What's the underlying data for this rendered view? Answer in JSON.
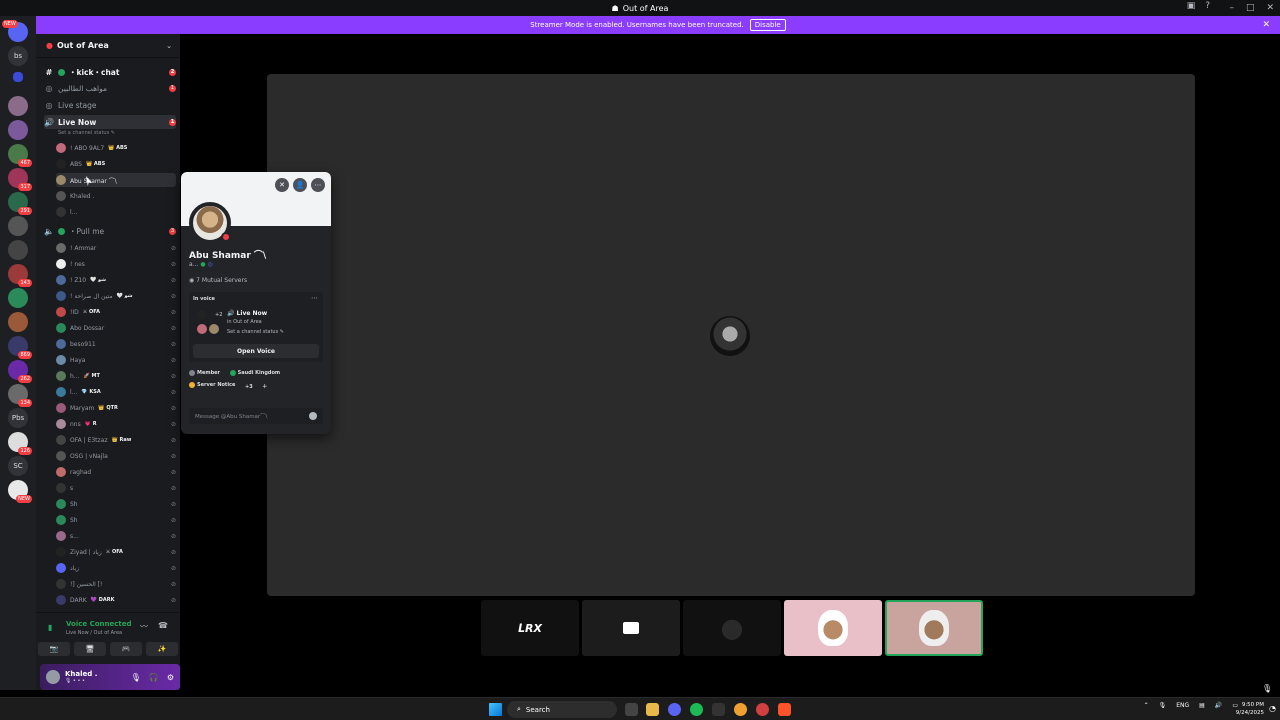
{
  "window": {
    "title": "Out of Area",
    "controls": [
      "–",
      "□",
      "✕"
    ]
  },
  "banner": {
    "text": "Streamer Mode is enabled. Usernames have been truncated.",
    "button": "Disable"
  },
  "rail": {
    "items": [
      {
        "label": "",
        "badge": "NEW"
      },
      {
        "label": "bs",
        "badge": ""
      },
      {
        "label": "",
        "badge": ""
      },
      {
        "label": "",
        "badge": ""
      },
      {
        "label": "",
        "badge": ""
      },
      {
        "label": "",
        "badge": "467"
      },
      {
        "label": "",
        "badge": "317"
      },
      {
        "label": "",
        "badge": "291"
      },
      {
        "label": "",
        "badge": ""
      },
      {
        "label": "",
        "badge": ""
      },
      {
        "label": "",
        "badge": "143"
      },
      {
        "label": "",
        "badge": ""
      },
      {
        "label": "",
        "badge": ""
      },
      {
        "label": "",
        "badge": "869"
      },
      {
        "label": "",
        "badge": "262"
      },
      {
        "label": "",
        "badge": "134"
      },
      {
        "label": "Pbs",
        "badge": ""
      },
      {
        "label": "",
        "badge": "126"
      },
      {
        "label": "SC",
        "badge": ""
      },
      {
        "label": "",
        "badge": "NEW"
      }
    ]
  },
  "server": {
    "name": "Out of Area"
  },
  "channels": {
    "kick_chat": {
      "name": "・kick・chat",
      "mention": "2"
    },
    "c2": {
      "name": "مواهب الطالبين",
      "mention": "1"
    },
    "live_stage": {
      "name": "Live stage"
    },
    "live_now": {
      "name": "Live Now",
      "mention": "1",
      "status": "Set a channel status ✎"
    },
    "pull_me": {
      "name": "・Pull me",
      "mention": "3"
    }
  },
  "live_now_users": [
    {
      "name": "! ABO 9AL7",
      "tag": "👑 ABS"
    },
    {
      "name": "ABS",
      "tag": "👑 ABS"
    },
    {
      "name": "Abu Shamar ⌒\\",
      "tag": ""
    },
    {
      "name": "Khaled .",
      "tag": ""
    },
    {
      "name": "l...",
      "tag": ""
    }
  ],
  "pull_me_users": [
    {
      "name": "! Ammar",
      "tag": ""
    },
    {
      "name": "! nes",
      "tag": ""
    },
    {
      "name": "! Z10",
      "tag": "🤍 شو"
    },
    {
      "name": "! متين ال صراحة",
      "tag": "🤍 شو"
    },
    {
      "name": "!ID",
      "tag": "⚔ OFA"
    },
    {
      "name": "Abo Dossar",
      "tag": ""
    },
    {
      "name": "beso911",
      "tag": ""
    },
    {
      "name": "Haya",
      "tag": ""
    },
    {
      "name": "h...",
      "tag": "🚀 MT"
    },
    {
      "name": "l...",
      "tag": "💎 KSA"
    },
    {
      "name": "Maryam",
      "tag": "👑 QTR"
    },
    {
      "name": "nns",
      "tag": "💗 R"
    },
    {
      "name": "OFA | E3tzaz",
      "tag": "👑 Raw"
    },
    {
      "name": "OSG | vNajla",
      "tag": ""
    },
    {
      "name": "raghad",
      "tag": ""
    },
    {
      "name": "s",
      "tag": ""
    },
    {
      "name": "Sh",
      "tag": ""
    },
    {
      "name": "Sh",
      "tag": ""
    },
    {
      "name": "s...",
      "tag": ""
    },
    {
      "name": "Ziyad | زياد",
      "tag": "⚔ OFA"
    },
    {
      "name": "زياد",
      "tag": ""
    },
    {
      "name": "!] الحسين [!",
      "tag": ""
    },
    {
      "name": "DARK",
      "tag": "💜 DARK"
    }
  ],
  "voice": {
    "status": "Voice Connected",
    "location": "Live Now / Out of Area",
    "buttons": [
      "📷",
      "🖥",
      "🎮",
      "✨"
    ]
  },
  "me": {
    "name": "Khaled .",
    "sub": "🎙 • • •"
  },
  "popout": {
    "name": "Abu Shamar ⌒\\",
    "handle": "a...",
    "mutual": "7 Mutual Servers",
    "in_voice_label": "In voice",
    "voice_channel": "🔊 Live Now",
    "voice_server": "in Out of Area",
    "voice_status": "Set a channel status ✎",
    "participants_more": "+2",
    "open_voice": "Open Voice",
    "roles": [
      {
        "name": "Member",
        "color": "#80848e"
      },
      {
        "name": "Saudi Kingdom",
        "color": "#23a55a"
      },
      {
        "name": "Server Notice",
        "color": "#f0b232"
      },
      {
        "name": "+3",
        "color": ""
      }
    ],
    "message_placeholder": "Message @Abu Shamar⌒\\"
  },
  "tiles": [
    {
      "label": "ᒪRX"
    },
    {
      "label": ""
    },
    {
      "label": ""
    },
    {
      "label": ""
    },
    {
      "label": ""
    }
  ],
  "taskbar": {
    "search": "Search",
    "lang": "ENG",
    "time": "9:50 PM",
    "date": "9/24/2025"
  }
}
